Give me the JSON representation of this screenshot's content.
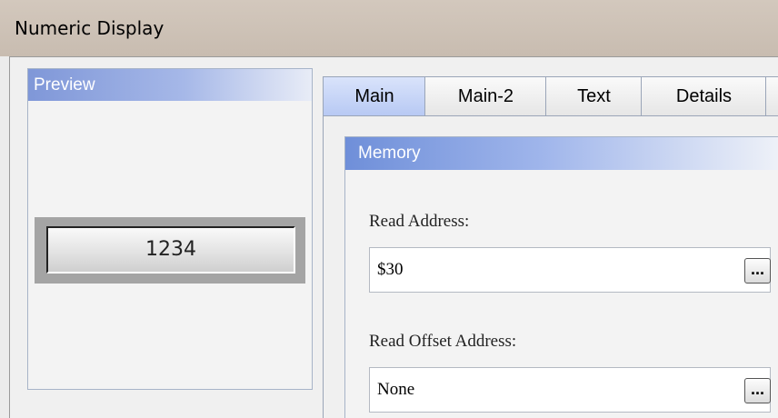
{
  "window": {
    "title": "Numeric Display"
  },
  "preview": {
    "header": "Preview",
    "value": "1234"
  },
  "tabs": [
    {
      "label": "Main",
      "active": true
    },
    {
      "label": "Main-2",
      "active": false
    },
    {
      "label": "Text",
      "active": false
    },
    {
      "label": "Details",
      "active": false
    }
  ],
  "memory": {
    "header": "Memory",
    "read_address_label": "Read Address:",
    "read_address_value": "$30",
    "read_offset_label": "Read Offset Address:",
    "read_offset_value": "None",
    "browse_label": "..."
  },
  "colors": {
    "header_blue": "#7f97d8",
    "active_tab": "#c4d4f7",
    "title_bar": "#cfc4b8"
  }
}
